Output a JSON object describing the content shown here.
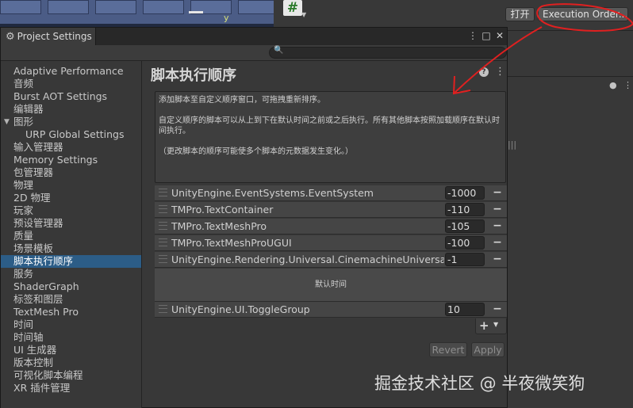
{
  "background": {
    "scene_gizmo_axis": "y",
    "script_icon_glyph": "#",
    "buttons": {
      "open_label": "打开",
      "execution_order_label": "Execution Order..."
    }
  },
  "window": {
    "tab_title": "Project Settings",
    "tab_icon": "gear-icon",
    "controls": {
      "kebab": "⋮",
      "maximize": "□",
      "close": "✕"
    }
  },
  "sidebar": {
    "items": [
      {
        "label": "Adaptive Performance"
      },
      {
        "label": "音频"
      },
      {
        "label": "Burst AOT Settings"
      },
      {
        "label": "编辑器"
      },
      {
        "label": "图形"
      },
      {
        "label": "URP Global Settings"
      },
      {
        "label": "输入管理器"
      },
      {
        "label": "Memory Settings"
      },
      {
        "label": "包管理器"
      },
      {
        "label": "物理"
      },
      {
        "label": "2D 物理"
      },
      {
        "label": "玩家"
      },
      {
        "label": "预设管理器"
      },
      {
        "label": "质量"
      },
      {
        "label": "场景模板"
      },
      {
        "label": "脚本执行顺序"
      },
      {
        "label": "服务"
      },
      {
        "label": "ShaderGraph"
      },
      {
        "label": "标签和图层"
      },
      {
        "label": "TextMesh Pro"
      },
      {
        "label": "时间"
      },
      {
        "label": "时间轴"
      },
      {
        "label": "UI 生成器"
      },
      {
        "label": "版本控制"
      },
      {
        "label": "可视化脚本编程"
      },
      {
        "label": "XR 插件管理"
      }
    ],
    "selected": "脚本执行顺序",
    "expanded": "图形"
  },
  "content": {
    "title": "脚本执行顺序",
    "help": {
      "line1": "添加脚本至自定义顺序窗口，可拖拽重新排序。",
      "line2": "自定义顺序的脚本可以从上到下在默认时间之前或之后执行。所有其他脚本按照加载顺序在默认时间执行。",
      "line3": "（更改脚本的顺序可能使多个脚本的元数据发生变化。）"
    },
    "before_default": [
      {
        "name": "UnityEngine.EventSystems.EventSystem",
        "order": "-1000"
      },
      {
        "name": "TMPro.TextContainer",
        "order": "-110"
      },
      {
        "name": "TMPro.TextMeshPro",
        "order": "-105"
      },
      {
        "name": "TMPro.TextMeshProUGUI",
        "order": "-100"
      },
      {
        "name": "UnityEngine.Rendering.Universal.CinemachineUniversalPixe",
        "order": "-1"
      }
    ],
    "default_time_label": "默认时间",
    "after_default": [
      {
        "name": "UnityEngine.UI.ToggleGroup",
        "order": "10"
      }
    ],
    "remove_glyph": "−",
    "add_glyph": "+",
    "revert_label": "Revert",
    "apply_label": "Apply"
  },
  "annotation_color": "#e02020",
  "watermark": "掘金技术社区 @ 半夜微笑狗"
}
